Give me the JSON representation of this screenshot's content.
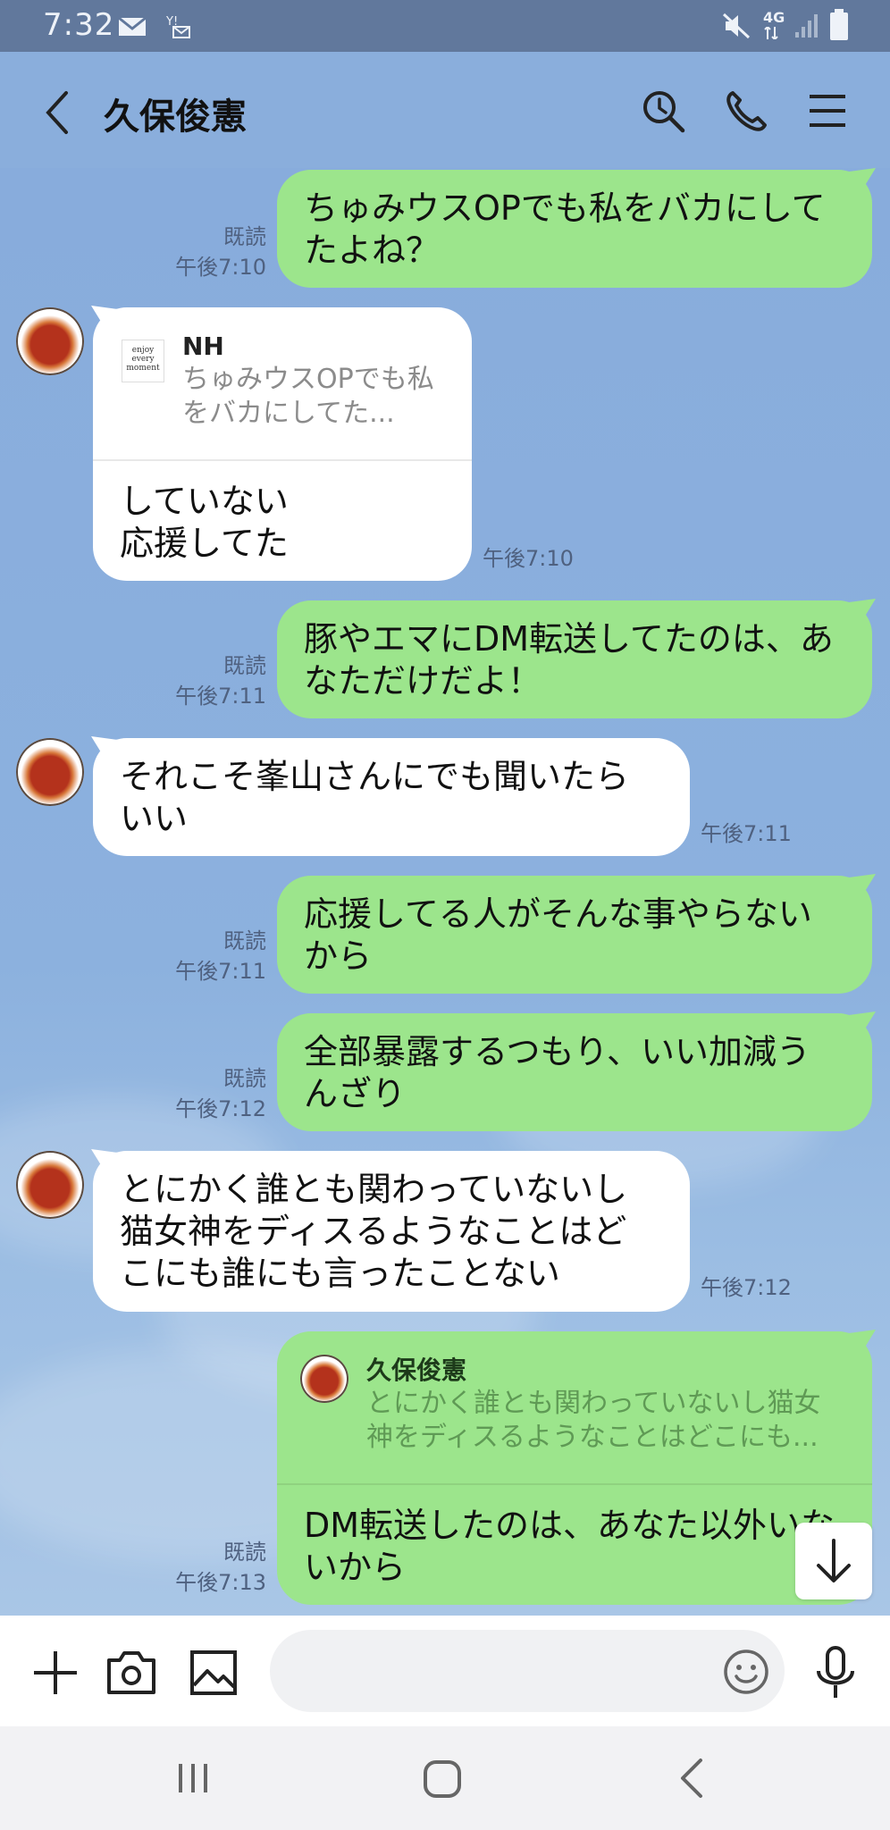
{
  "status_bar": {
    "time": "7:32",
    "network": "4G",
    "icons": [
      "mail-icon",
      "voicemail-icon",
      "mute-icon",
      "signal-icon",
      "battery-icon"
    ]
  },
  "header": {
    "title": "久保俊憲",
    "icons": [
      "back-arrow-icon",
      "search-icon",
      "phone-icon",
      "menu-icon"
    ]
  },
  "messages": [
    {
      "dir": "out",
      "text": "ちゅみウスOPでも私をバカにして\nたよね？",
      "read": "既読",
      "time": "午後7:10"
    },
    {
      "dir": "in",
      "reply_to": {
        "name": "NH",
        "text": "ちゅみウスOPでも私\nをバカにしてた..."
      },
      "text": "していない\n応援してた",
      "time": "午後7:10"
    },
    {
      "dir": "out",
      "text": "豚やエマにDM転送してたのは、あ\nなただけだよ！",
      "read": "既読",
      "time": "午後7:11"
    },
    {
      "dir": "in",
      "text": "それこそ峯山さんにでも聞いたら\nいい",
      "time": "午後7:11"
    },
    {
      "dir": "out",
      "text": "応援してる人がそんな事やらない\nから",
      "read": "既読",
      "time": "午後7:11"
    },
    {
      "dir": "out",
      "text": "全部暴露するつもり、いい加減う\nんざり",
      "read": "既読",
      "time": "午後7:12"
    },
    {
      "dir": "in",
      "text": "とにかく誰とも関わっていないし\n猫女神をディスるようなことはど\nこにも誰にも言ったことない",
      "time": "午後7:12"
    },
    {
      "dir": "out",
      "reply_to": {
        "name": "久保俊憲",
        "text": "とにかく誰とも関わっていないし猫女\n神をディスるようなことはどこにも..."
      },
      "text": "DM転送したのは、あなた以外いな\nいから",
      "read": "既読",
      "time": "午後7:13"
    }
  ],
  "input": {
    "placeholder": "",
    "icons": [
      "plus-icon",
      "camera-icon",
      "image-icon",
      "emoji-icon",
      "microphone-icon"
    ]
  },
  "colors": {
    "chat_bg": "#8aaedc",
    "outgoing_bubble": "#9ce58c",
    "incoming_bubble": "#ffffff",
    "status_bar": "#61789c"
  }
}
